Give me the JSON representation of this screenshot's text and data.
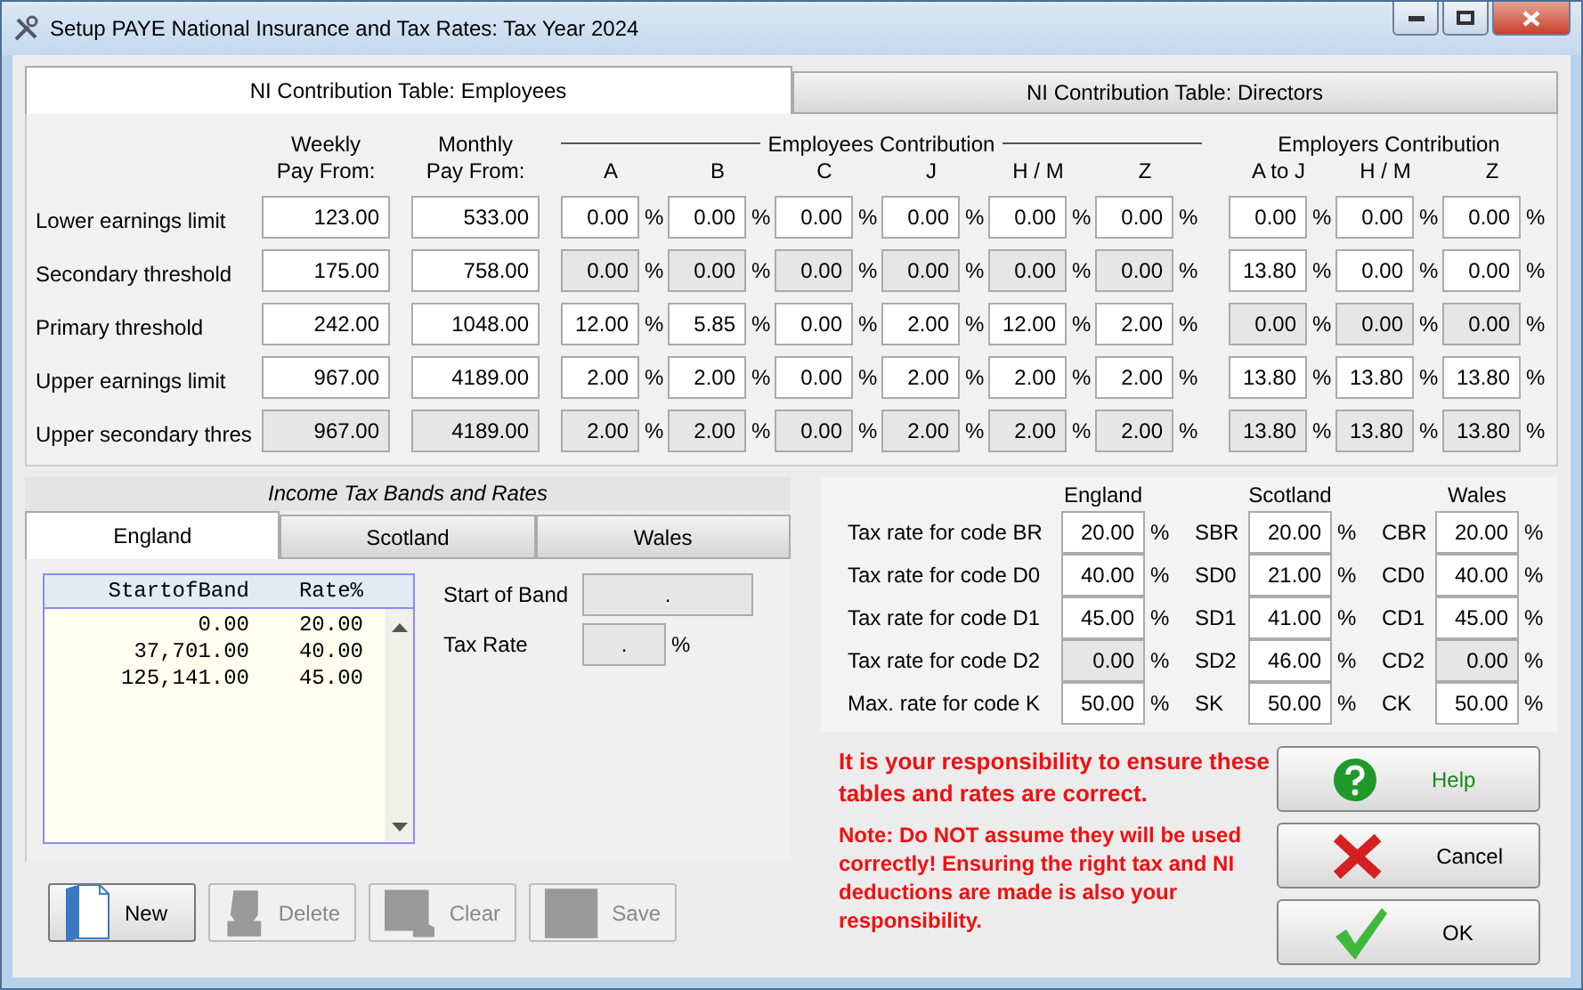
{
  "window": {
    "title": "Setup PAYE National Insurance and Tax Rates: Tax Year 2024"
  },
  "ni_tabs": [
    {
      "label": "NI Contribution Table: Employees",
      "selected": true
    },
    {
      "label": "NI Contribution Table: Directors",
      "selected": false
    }
  ],
  "ni_table": {
    "pay_columns": [
      {
        "line1": "Weekly",
        "line2": "Pay From:"
      },
      {
        "line1": "Monthly",
        "line2": "Pay From:"
      }
    ],
    "employees_heading": "Employees Contribution",
    "employees_columns": [
      "A",
      "B",
      "C",
      "J",
      "H / M",
      "Z"
    ],
    "employers_heading": "Employers Contribution",
    "employers_columns": [
      "A to J",
      "H / M",
      "Z"
    ],
    "rows": [
      {
        "label": "Lower earnings limit",
        "pay": [
          {
            "value": "123.00",
            "disabled": false
          },
          {
            "value": "533.00",
            "disabled": false
          }
        ],
        "employees": [
          {
            "value": "0.00",
            "unit": "%",
            "disabled": false
          },
          {
            "value": "0.00",
            "unit": "%",
            "disabled": false
          },
          {
            "value": "0.00",
            "unit": "%",
            "disabled": false
          },
          {
            "value": "0.00",
            "unit": "%",
            "disabled": false
          },
          {
            "value": "0.00",
            "unit": "%",
            "disabled": false
          },
          {
            "value": "0.00",
            "unit": "%",
            "disabled": false
          }
        ],
        "employers": [
          {
            "value": "0.00",
            "unit": "%",
            "disabled": false
          },
          {
            "value": "0.00",
            "unit": "%",
            "disabled": false
          },
          {
            "value": "0.00",
            "unit": "%",
            "disabled": false
          }
        ]
      },
      {
        "label": "Secondary threshold",
        "pay": [
          {
            "value": "175.00",
            "disabled": false
          },
          {
            "value": "758.00",
            "disabled": false
          }
        ],
        "employees": [
          {
            "value": "0.00",
            "unit": "%",
            "disabled": true
          },
          {
            "value": "0.00",
            "unit": "%",
            "disabled": true
          },
          {
            "value": "0.00",
            "unit": "%",
            "disabled": true
          },
          {
            "value": "0.00",
            "unit": "%",
            "disabled": true
          },
          {
            "value": "0.00",
            "unit": "%",
            "disabled": true
          },
          {
            "value": "0.00",
            "unit": "%",
            "disabled": true
          }
        ],
        "employers": [
          {
            "value": "13.80",
            "unit": "%",
            "disabled": false
          },
          {
            "value": "0.00",
            "unit": "%",
            "disabled": false
          },
          {
            "value": "0.00",
            "unit": "%",
            "disabled": false
          }
        ]
      },
      {
        "label": "Primary threshold",
        "pay": [
          {
            "value": "242.00",
            "disabled": false
          },
          {
            "value": "1048.00",
            "disabled": false
          }
        ],
        "employees": [
          {
            "value": "12.00",
            "unit": "%",
            "disabled": false
          },
          {
            "value": "5.85",
            "unit": "%",
            "disabled": false
          },
          {
            "value": "0.00",
            "unit": "%",
            "disabled": false
          },
          {
            "value": "2.00",
            "unit": "%",
            "disabled": false
          },
          {
            "value": "12.00",
            "unit": "%",
            "disabled": false
          },
          {
            "value": "2.00",
            "unit": "%",
            "disabled": false
          }
        ],
        "employers": [
          {
            "value": "0.00",
            "unit": "%",
            "disabled": true
          },
          {
            "value": "0.00",
            "unit": "%",
            "disabled": true
          },
          {
            "value": "0.00",
            "unit": "%",
            "disabled": true
          }
        ]
      },
      {
        "label": "Upper earnings limit",
        "pay": [
          {
            "value": "967.00",
            "disabled": false
          },
          {
            "value": "4189.00",
            "disabled": false
          }
        ],
        "employees": [
          {
            "value": "2.00",
            "unit": "%",
            "disabled": false
          },
          {
            "value": "2.00",
            "unit": "%",
            "disabled": false
          },
          {
            "value": "0.00",
            "unit": "%",
            "disabled": false
          },
          {
            "value": "2.00",
            "unit": "%",
            "disabled": false
          },
          {
            "value": "2.00",
            "unit": "%",
            "disabled": false
          },
          {
            "value": "2.00",
            "unit": "%",
            "disabled": false
          }
        ],
        "employers": [
          {
            "value": "13.80",
            "unit": "%",
            "disabled": false
          },
          {
            "value": "13.80",
            "unit": "%",
            "disabled": false
          },
          {
            "value": "13.80",
            "unit": "%",
            "disabled": false
          }
        ]
      },
      {
        "label": "Upper secondary thres",
        "pay": [
          {
            "value": "967.00",
            "disabled": true
          },
          {
            "value": "4189.00",
            "disabled": true
          }
        ],
        "employees": [
          {
            "value": "2.00",
            "unit": "%",
            "disabled": true
          },
          {
            "value": "2.00",
            "unit": "%",
            "disabled": true
          },
          {
            "value": "0.00",
            "unit": "%",
            "disabled": true
          },
          {
            "value": "2.00",
            "unit": "%",
            "disabled": true
          },
          {
            "value": "2.00",
            "unit": "%",
            "disabled": true
          },
          {
            "value": "2.00",
            "unit": "%",
            "disabled": true
          }
        ],
        "employers": [
          {
            "value": "13.80",
            "unit": "%",
            "disabled": true
          },
          {
            "value": "13.80",
            "unit": "%",
            "disabled": true
          },
          {
            "value": "13.80",
            "unit": "%",
            "disabled": true
          }
        ]
      }
    ]
  },
  "income_tax": {
    "title": "Income Tax Bands and Rates",
    "tabs": [
      {
        "label": "England",
        "selected": true
      },
      {
        "label": "Scotland",
        "selected": false
      },
      {
        "label": "Wales",
        "selected": false
      }
    ],
    "list": {
      "columns": [
        "StartofBand",
        "Rate%"
      ],
      "rows": [
        [
          "0.00",
          "20.00"
        ],
        [
          "37,701.00",
          "40.00"
        ],
        [
          "125,141.00",
          "45.00"
        ]
      ]
    },
    "start_of_band": {
      "label": "Start of Band",
      "value": "."
    },
    "tax_rate": {
      "label": "Tax Rate",
      "value": ".",
      "unit": "%"
    },
    "buttons": [
      {
        "label": "New",
        "kind": "new",
        "disabled": false
      },
      {
        "label": "Delete",
        "kind": "delete",
        "disabled": true
      },
      {
        "label": "Clear",
        "kind": "clear",
        "disabled": true
      },
      {
        "label": "Save",
        "kind": "save",
        "disabled": true
      }
    ]
  },
  "tax_rates": {
    "columns": [
      "England",
      "Scotland",
      "Wales"
    ],
    "rows": [
      {
        "label": "Tax rate for code BR",
        "cells": [
          {
            "value": "20.00",
            "unit": "%",
            "disabled": false
          },
          {
            "code": "SBR",
            "value": "20.00",
            "unit": "%",
            "disabled": false
          },
          {
            "code": "CBR",
            "value": "20.00",
            "unit": "%",
            "disabled": false
          }
        ]
      },
      {
        "label": "Tax rate for code D0",
        "cells": [
          {
            "value": "40.00",
            "unit": "%",
            "disabled": false
          },
          {
            "code": "SD0",
            "value": "21.00",
            "unit": "%",
            "disabled": false
          },
          {
            "code": "CD0",
            "value": "40.00",
            "unit": "%",
            "disabled": false
          }
        ]
      },
      {
        "label": "Tax rate for code D1",
        "cells": [
          {
            "value": "45.00",
            "unit": "%",
            "disabled": false
          },
          {
            "code": "SD1",
            "value": "41.00",
            "unit": "%",
            "disabled": false
          },
          {
            "code": "CD1",
            "value": "45.00",
            "unit": "%",
            "disabled": false
          }
        ]
      },
      {
        "label": "Tax rate for code D2",
        "cells": [
          {
            "value": "0.00",
            "unit": "%",
            "disabled": true
          },
          {
            "code": "SD2",
            "value": "46.00",
            "unit": "%",
            "disabled": false
          },
          {
            "code": "CD2",
            "value": "0.00",
            "unit": "%",
            "disabled": true
          }
        ]
      },
      {
        "label": "Max. rate for code K",
        "cells": [
          {
            "value": "50.00",
            "unit": "%",
            "disabled": false
          },
          {
            "code": "SK",
            "value": "50.00",
            "unit": "%",
            "disabled": false
          },
          {
            "code": "CK",
            "value": "50.00",
            "unit": "%",
            "disabled": false
          }
        ]
      }
    ]
  },
  "warning": "It is your responsibility to ensure these tables and rates are correct.",
  "note": "Note: Do NOT assume they will be used correctly!  Ensuring the right tax and NI deductions are made is also your responsibility.",
  "actions": [
    {
      "label": "Help",
      "kind": "help"
    },
    {
      "label": "Cancel",
      "kind": "cancel"
    },
    {
      "label": "OK",
      "kind": "ok"
    }
  ]
}
